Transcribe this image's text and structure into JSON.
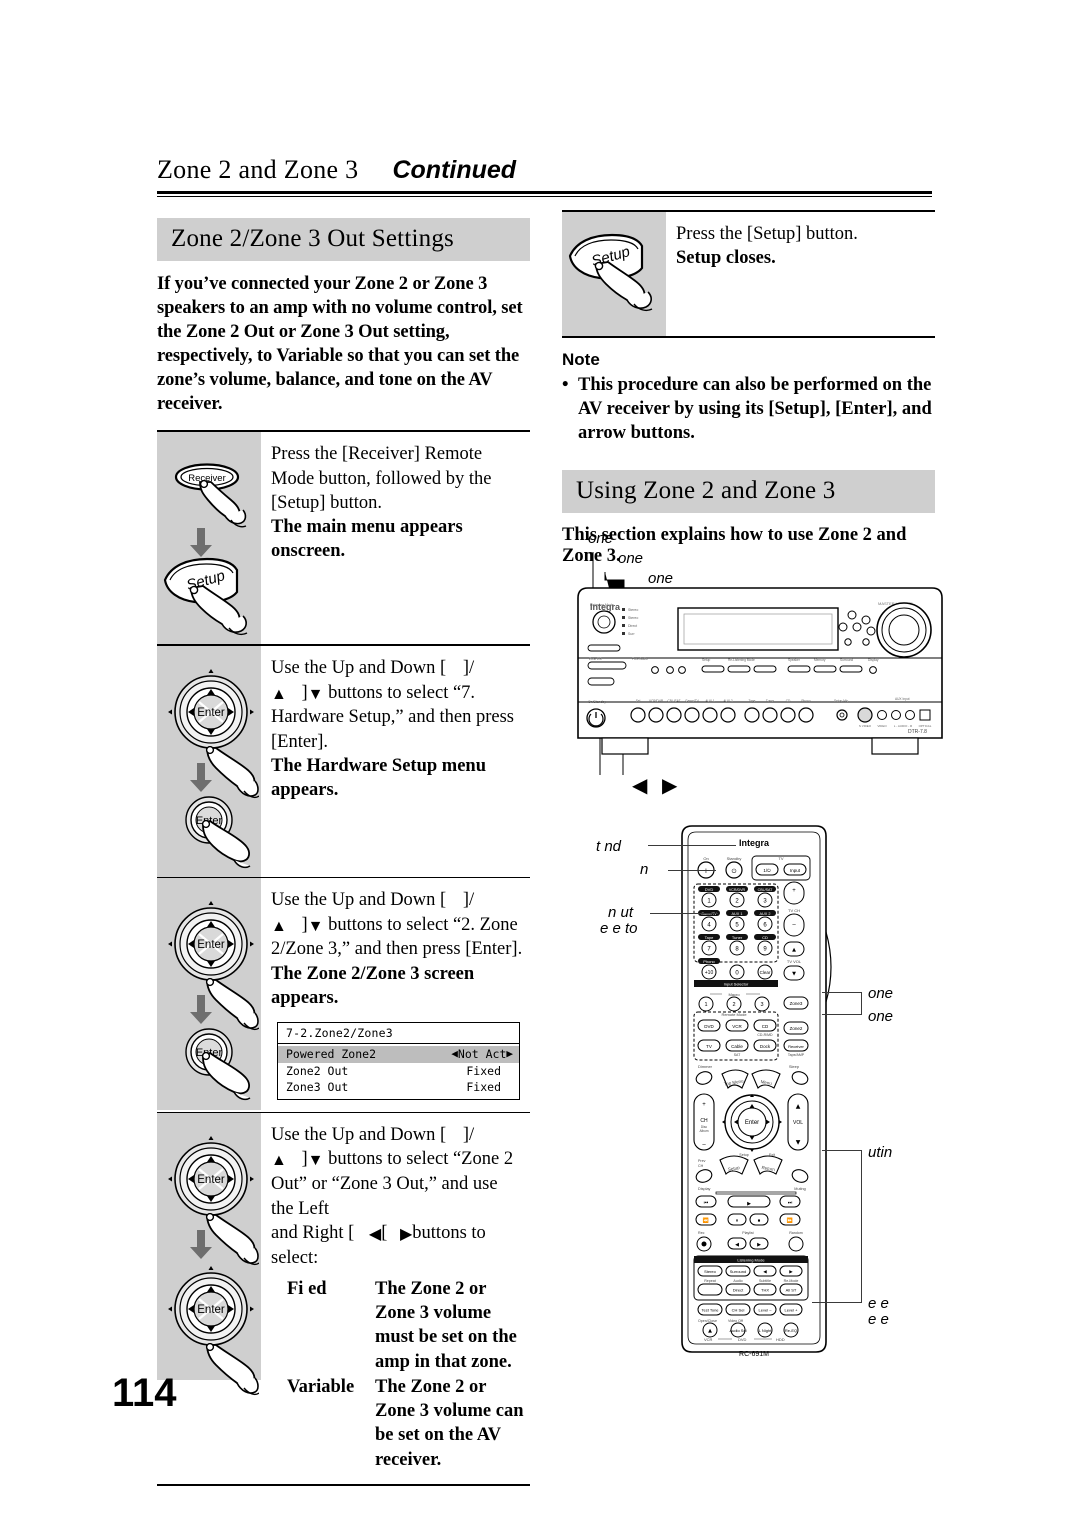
{
  "header": {
    "title": "Zone 2 and Zone 3",
    "continued": "Continued"
  },
  "page_number": "114",
  "left_column": {
    "section_title": "Zone 2/Zone 3 Out Settings",
    "intro": "If you’ve connected your Zone 2 or Zone 3 speakers to an amp with no volume control, set the Zone 2 Out or Zone 3 Out setting, respectively, to Variable so that you can set the zone’s volume, balance, and tone on the AV receiver.",
    "steps": [
      {
        "icons": [
          "receiver-button",
          "down-arrow",
          "setup-button"
        ],
        "text": "Press the [Receiver] Remote Mode button, followed by the [Setup] button.",
        "result": "The main menu appears onscreen."
      },
      {
        "icons": [
          "nav-dial",
          "down-arrow",
          "enter-button"
        ],
        "text_a": "Use the Up and Down [",
        "text_b": "]/",
        "text_c": "]",
        "text_d": "buttons to select “7. Hardware Setup,” and then press [Enter].",
        "result": "The Hardware Setup menu appears."
      },
      {
        "icons": [
          "nav-dial",
          "down-arrow",
          "enter-button"
        ],
        "text_a": "Use the Up and Down [",
        "text_b": "]/",
        "text_c": "]",
        "text_d": "buttons to select “2. Zone 2/Zone 3,” and then press [Enter].",
        "result": "The Zone 2/Zone 3 screen appears."
      },
      {
        "icons": [
          "nav-dial",
          "down-arrow",
          "nav-dial"
        ],
        "text_a": "Use the Up and Down [",
        "text_b": "]/",
        "text_c": "]",
        "text_d": "buttons to select “Zone 2 Out” or “Zone 3 Out,” and use the Left",
        "text_e": "and Right [",
        "text_f": "[",
        "text_g": "buttons to",
        "text_h": "select:"
      }
    ],
    "osd": {
      "title": "7-2.Zone2/Zone3",
      "rows": [
        {
          "key": "Powered Zone2",
          "value": "Not Act",
          "selected": true,
          "carets": true
        },
        {
          "key": "Zone2 Out",
          "value": "Fixed",
          "selected": false,
          "carets": false
        },
        {
          "key": "Zone3 Out",
          "value": "Fixed",
          "selected": false,
          "carets": false
        }
      ]
    },
    "definitions": [
      {
        "term": "Fi ed",
        "desc": "The Zone 2 or Zone 3 volume must be set on the amp in that zone."
      },
      {
        "term": "Variable",
        "desc": "The Zone 2 or Zone 3 volume can be set on the AV receiver."
      }
    ]
  },
  "right_column": {
    "final_step": {
      "icons": [
        "setup-button"
      ],
      "text": "Press the [Setup] button.",
      "result": "Setup closes."
    },
    "note": {
      "heading": "Note",
      "bullet": "•",
      "items": [
        "This procedure can also be performed on the AV receiver by using its [Setup], [Enter], and arrow buttons."
      ]
    },
    "section_title": "Using Zone 2 and Zone 3",
    "intro": "This section explains how to use Zone 2 and Zone 3.",
    "receiver": {
      "brand": "Integra",
      "model": "DTR-7.8",
      "callouts": [
        "one",
        "one",
        "one"
      ],
      "arrow_left": "◀",
      "arrow_right": "▶"
    },
    "remote": {
      "brand": "Integra",
      "model": "RC-691M",
      "callouts_left": [
        "t nd",
        "n",
        "n ut",
        "e e to"
      ],
      "callouts_right": [
        "one",
        "one",
        "utin",
        "e e",
        "e e"
      ],
      "labels": {
        "on": "On",
        "standby": "Standby",
        "tv": "TV",
        "tv_power": "1/⏻",
        "tv_input": "Input",
        "tv_ch": "TV CH",
        "tv_vol": "TV VOL",
        "plus": "+",
        "minus": "–",
        "up": "▲",
        "down": "▼",
        "keys": [
          "1",
          "2",
          "3",
          "4",
          "5",
          "6",
          "7",
          "8",
          "9",
          "+10",
          "0",
          "Clear"
        ],
        "key_tops": [
          "DVD",
          "VCR/DVR",
          "CD/SAT",
          "Cable/TV",
          "AUX 1",
          "AUX 2",
          "Tape",
          "Tuner",
          "CD",
          "Phono"
        ],
        "input_selector": "Input Selector",
        "macro": "Macro",
        "macro_keys": [
          "1",
          "2",
          "3"
        ],
        "zone3": "Zone3",
        "zone2": "Zone2",
        "remote_mode": "Remote Mode",
        "mode_keys": [
          "DVD",
          "VCR",
          "CD",
          "TV",
          "Cable",
          "Dock",
          "Receiver"
        ],
        "mode_subs": [
          "CD-R/MD",
          "SAT",
          "Tape/AMP"
        ],
        "dimmer": "Dimmer",
        "sleep": "Sleep",
        "top_menu": "Top Menu",
        "menu": "Menu",
        "ch": "CH",
        "disc_album": "Disc Album",
        "vol": "VOL",
        "enter": "Enter",
        "setup": "Setup",
        "exit": "Exit",
        "prev_ch": "Prev CH",
        "return": "Return",
        "display": "Display",
        "muting": "Muting",
        "rec": "Rec",
        "playlist": "Playlist",
        "random": "Random",
        "listening_mode": "Listening Mode",
        "stereo": "Stereo",
        "surround": "Surround",
        "repeat": "Repeat",
        "audio": "Audio",
        "direct": "Direct",
        "subtitle": "Subtitle",
        "thx": "THX",
        "re_mode": "Re-Mode",
        "all_st": "All ST",
        "test_tone": "Test Tone",
        "ch_sel": "CH Sel",
        "level_minus": "Level –",
        "level_plus": "Level +",
        "open_close": "Open/Close",
        "video_off": "Video Off",
        "audio_sel": "Audio Sel",
        "l_night": "L Night",
        "re_eq": "Re-EQ",
        "vcr": "VCR",
        "dvd": "DVD",
        "hdd": "HDD"
      }
    }
  }
}
